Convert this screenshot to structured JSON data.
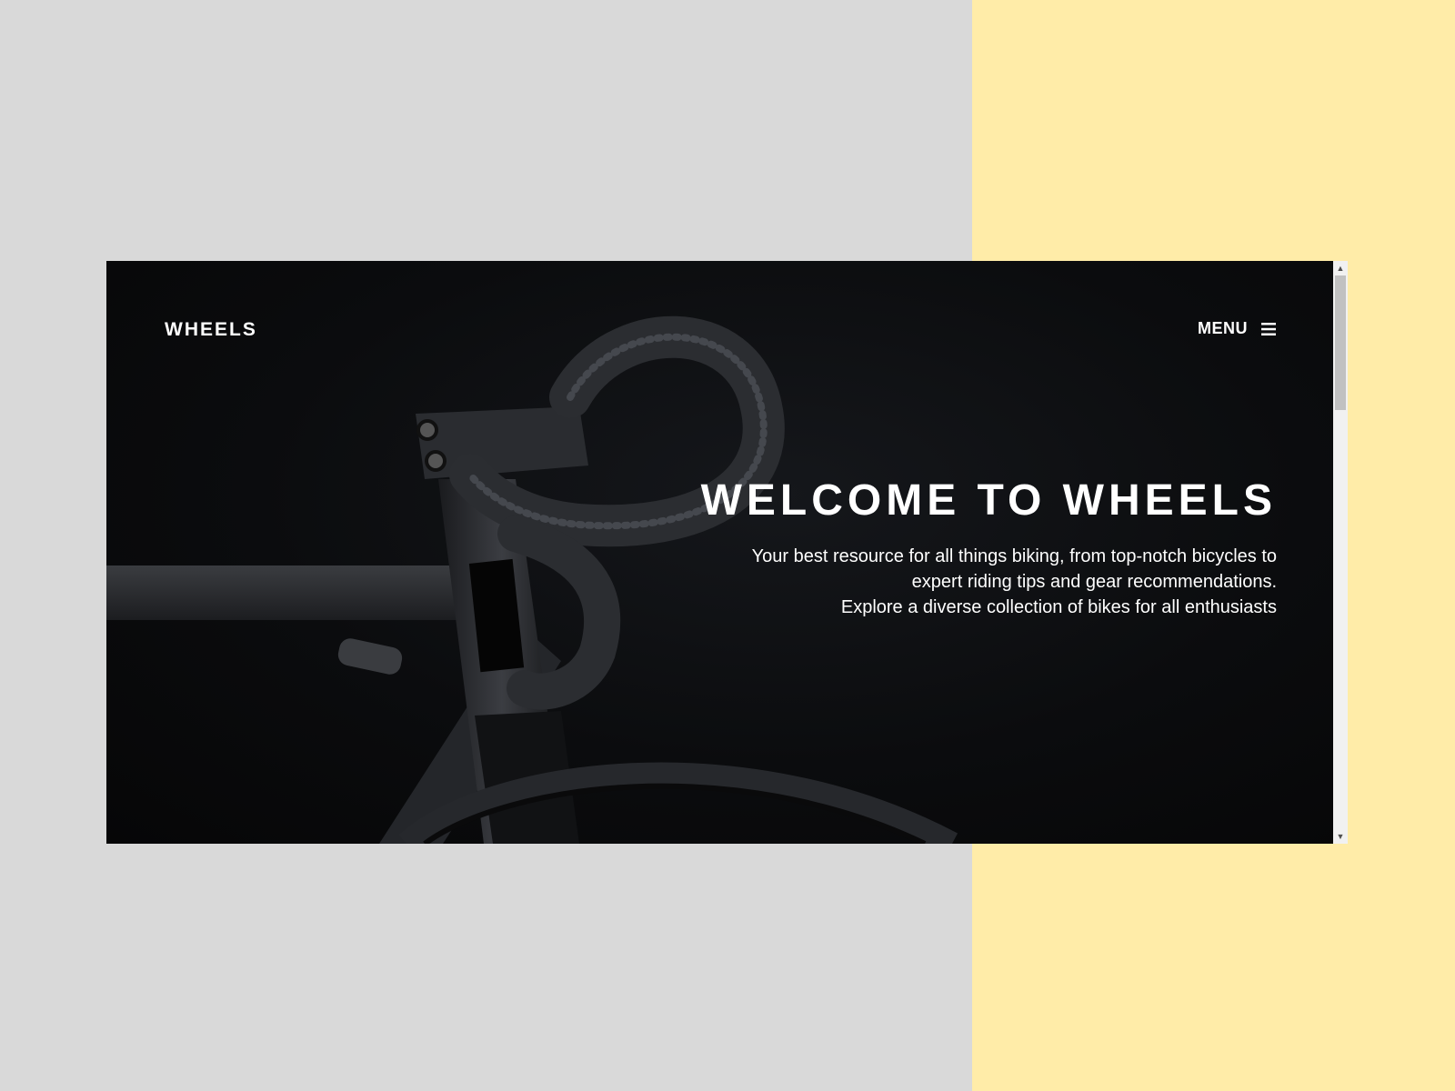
{
  "header": {
    "brand": "WHEELS",
    "menu_label": "MENU",
    "menu_icon": "hamburger-icon"
  },
  "hero": {
    "title": "WELCOME TO WHEELS",
    "lines": [
      "Your best resource for all things biking, from top-notch bicycles to",
      "expert riding tips and gear recommendations.",
      "Explore a diverse collection of bikes for all enthusiasts"
    ]
  },
  "scrollbar": {
    "up_icon": "scroll-up-arrow-icon",
    "down_icon": "scroll-down-arrow-icon"
  },
  "colors": {
    "backdrop": "#d9d9d9",
    "accent": "#ffeca8",
    "hero_bg": "#0b0c0e",
    "text": "#ffffff"
  }
}
